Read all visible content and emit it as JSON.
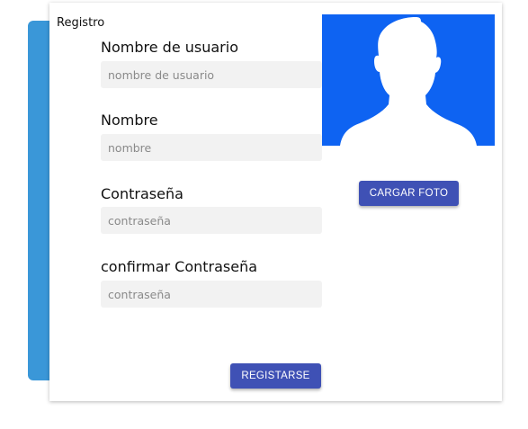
{
  "form": {
    "title": "Registro",
    "fields": [
      {
        "label": "Nombre de usuario",
        "placeholder": "nombre de usuario",
        "value": ""
      },
      {
        "label": "Nombre",
        "placeholder": "nombre",
        "value": ""
      },
      {
        "label": "Contraseña",
        "placeholder": "contraseña",
        "value": ""
      },
      {
        "label": "confirmar Contraseña",
        "placeholder": "contraseña",
        "value": ""
      }
    ],
    "upload_label": "CARGAR FOTO",
    "submit_label": "REGISTARSE"
  },
  "avatar": {
    "icon": "user-silhouette-icon",
    "background": "#0e63f2"
  },
  "colors": {
    "accent": "#3f51b5",
    "side_panel": "#3a97d8"
  }
}
